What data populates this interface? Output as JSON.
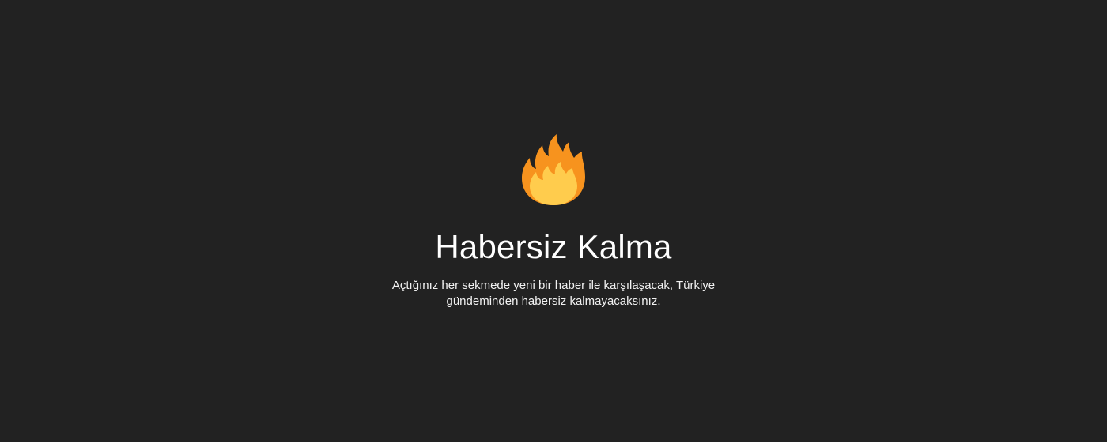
{
  "hero": {
    "icon": "fire-icon",
    "title": "Habersiz Kalma",
    "subtitle": "Açtığınız her sekmede yeni bir haber ile karşılaşacak, Türkiye gündeminden habersiz kalmayacaksınız."
  },
  "colors": {
    "background": "#222222",
    "text": "#ffffff",
    "flame_outer": "#f7931e",
    "flame_inner": "#ffcc4d"
  }
}
